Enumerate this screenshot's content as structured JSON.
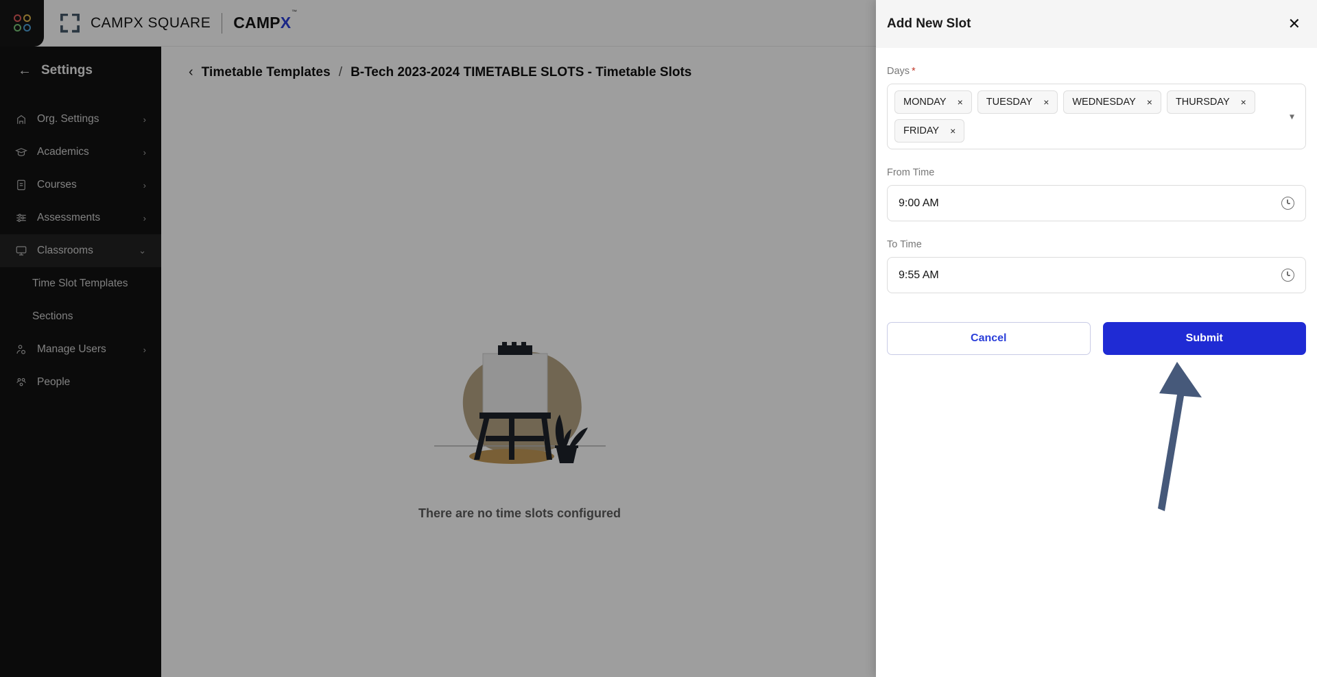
{
  "topbar": {
    "logo_icon": "four-dots-logo",
    "frame_icon": "frame-brackets-icon",
    "brand_primary": "CAMPX SQUARE",
    "brand_secondary_main": "CAMP",
    "brand_secondary_accent": "X",
    "brand_trademark": "™",
    "accent_color": "#2b3fd9"
  },
  "sidebar": {
    "back_icon": "arrow-left-icon",
    "title": "Settings",
    "items": [
      {
        "label": "Org. Settings",
        "icon": "building-icon",
        "chevron": "›",
        "active": false
      },
      {
        "label": "Academics",
        "icon": "graduation-cap-icon",
        "chevron": "›",
        "active": false
      },
      {
        "label": "Courses",
        "icon": "book-icon",
        "chevron": "›",
        "active": false
      },
      {
        "label": "Assessments",
        "icon": "sliders-icon",
        "chevron": "›",
        "active": false
      },
      {
        "label": "Classrooms",
        "icon": "monitor-icon",
        "chevron": "⌄",
        "active": true
      }
    ],
    "sub_items": [
      {
        "label": "Time Slot Templates"
      },
      {
        "label": "Sections"
      }
    ],
    "items_after": [
      {
        "label": "Manage Users",
        "icon": "user-check-icon",
        "chevron": "›"
      },
      {
        "label": "People",
        "icon": "people-group-icon",
        "chevron": ""
      }
    ]
  },
  "main": {
    "back_icon": "chevron-left-icon",
    "breadcrumb_parent": "Timetable Templates",
    "breadcrumb_separator": "/",
    "breadcrumb_current": "B-Tech 2023-2024 TIMETABLE SLOTS - Timetable Slots",
    "empty_illustration": "easel-with-plant-illustration",
    "empty_message": "There are no time slots configured"
  },
  "drawer": {
    "title": "Add New Slot",
    "close_icon": "close-icon",
    "days": {
      "label": "Days",
      "required_mark": "*",
      "caret_icon": "chevron-down-icon",
      "remove_icon": "×",
      "chips": [
        "MONDAY",
        "TUESDAY",
        "WEDNESDAY",
        "THURSDAY",
        "FRIDAY"
      ]
    },
    "from_time": {
      "label": "From Time",
      "value": "9:00 AM",
      "icon": "clock-icon"
    },
    "to_time": {
      "label": "To Time",
      "value": "9:55 AM",
      "icon": "clock-icon"
    },
    "cancel_label": "Cancel",
    "submit_label": "Submit",
    "submit_color": "#1f2bd4",
    "cancel_text_color": "#2b3fd9"
  },
  "annotation": {
    "arrow_icon": "upward-pointing-arrow",
    "color": "#46597a"
  }
}
